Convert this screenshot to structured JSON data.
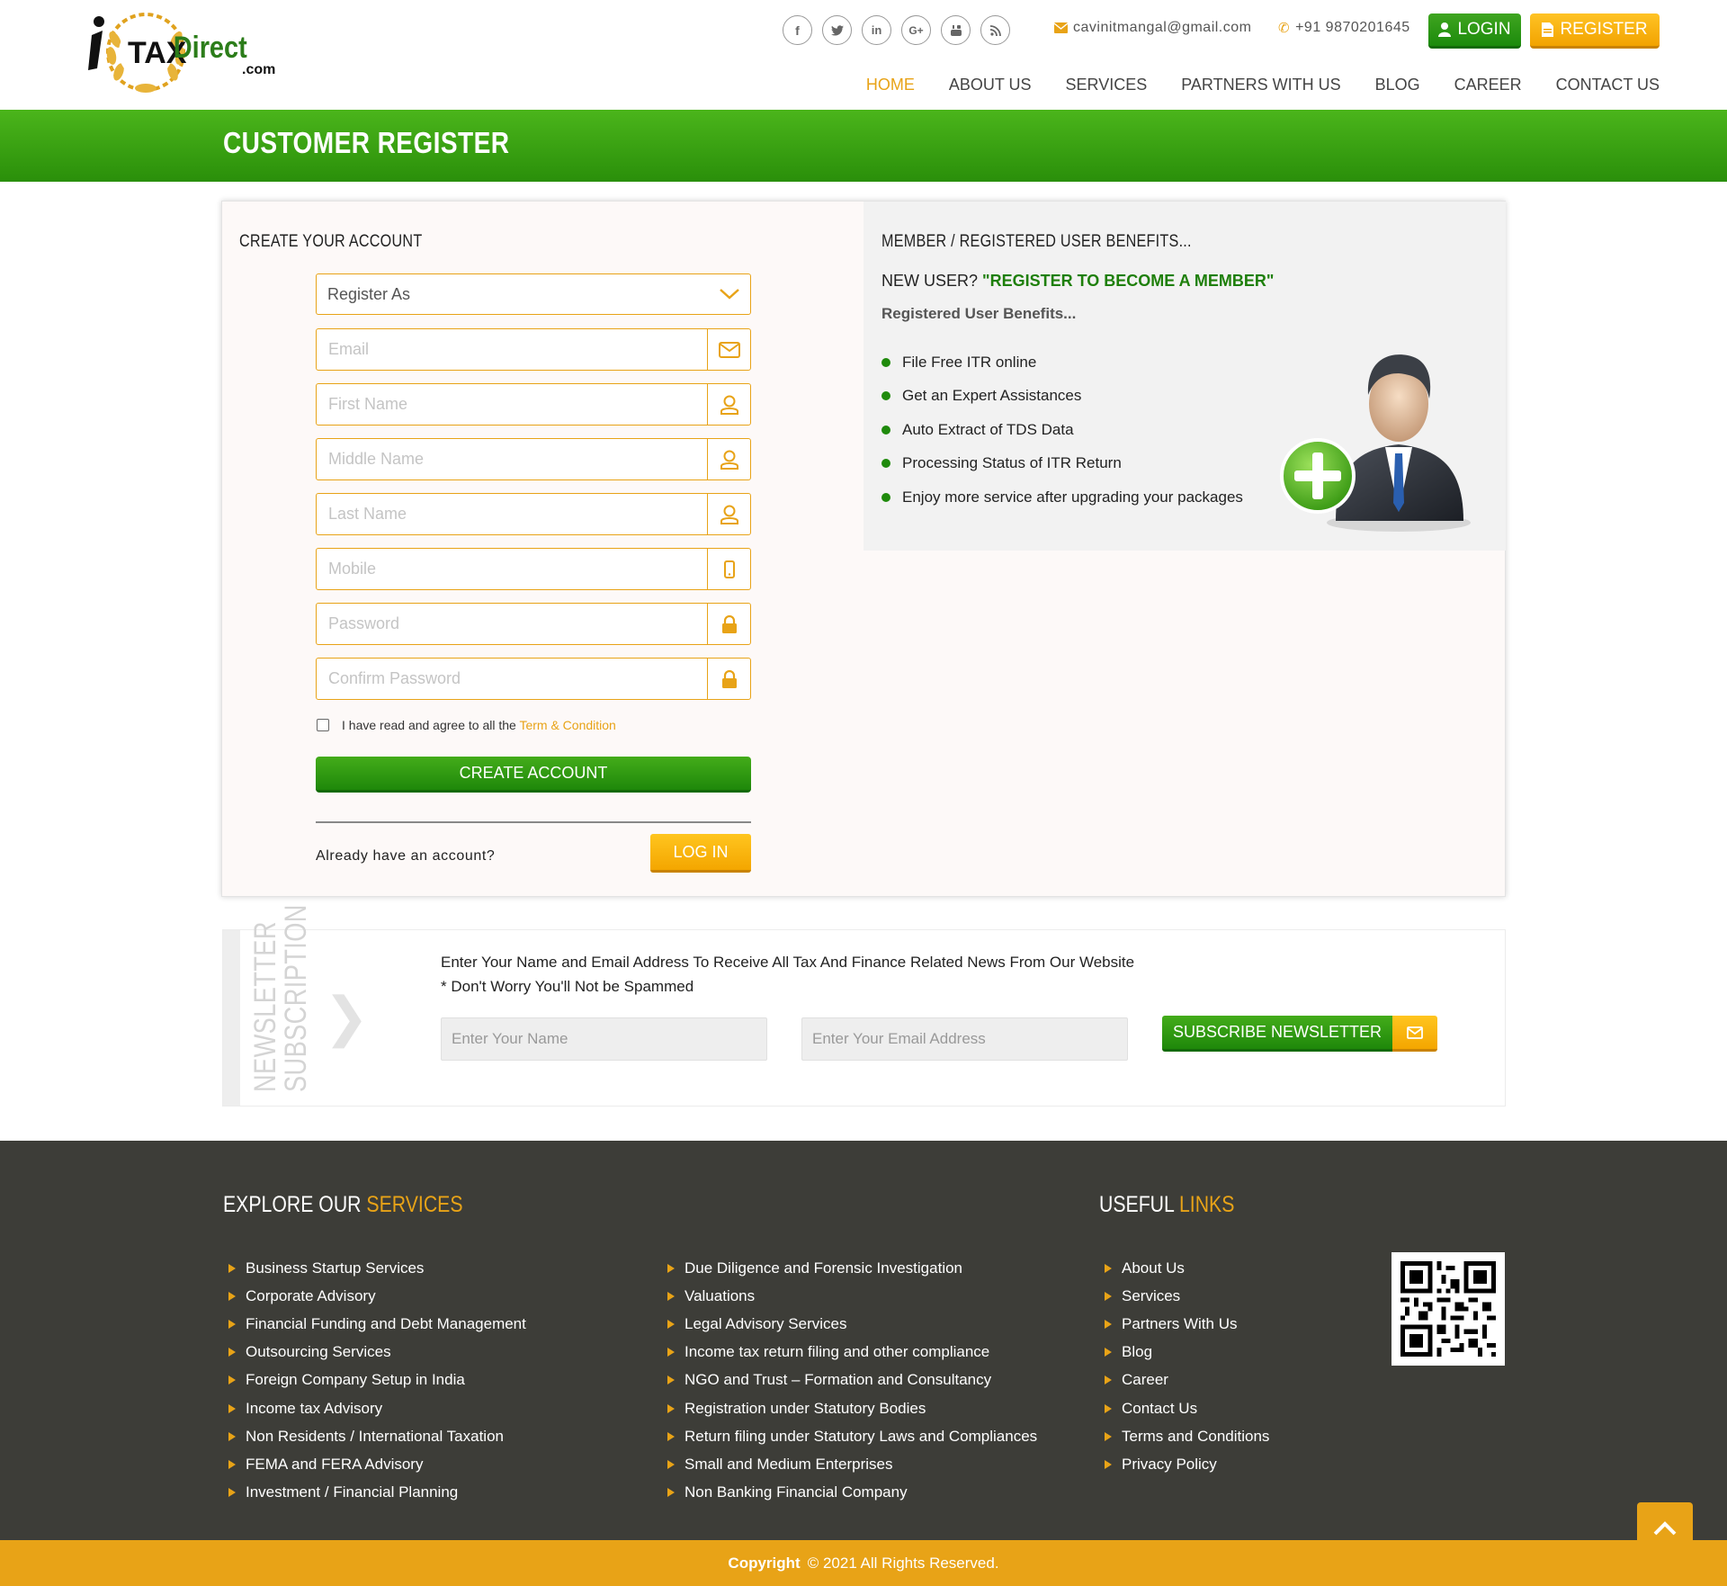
{
  "header": {
    "logo_text_main": "TAX",
    "logo_text_brand": "Direct",
    "logo_text_suffix": ".com",
    "social_icons": [
      "facebook-icon",
      "twitter-icon",
      "linkedin-icon",
      "google-plus-icon",
      "youtube-icon",
      "rss-icon"
    ],
    "email": "cavinitmangal@gmail.com",
    "phone": "+91 9870201645",
    "login_label": "LOGIN",
    "register_label": "REGISTER",
    "nav": [
      "HOME",
      "ABOUT US",
      "SERVICES",
      "PARTNERS WITH US",
      "BLOG",
      "CAREER",
      "CONTACT US"
    ],
    "active_nav": "HOME"
  },
  "banner": {
    "title": "CUSTOMER REGISTER"
  },
  "form": {
    "title": "CREATE YOUR ACCOUNT",
    "register_as": "Register As",
    "placeholders": {
      "email": "Email",
      "first_name": "First Name",
      "middle_name": "Middle Name",
      "last_name": "Last Name",
      "mobile": "Mobile",
      "password": "Password",
      "confirm_password": "Confirm Password"
    },
    "agree_text": "I have read and agree to all the",
    "agree_link": "Term & Condition",
    "create_label": "CREATE ACCOUNT",
    "already_text": "Already have an account?",
    "login_label": "LOG IN"
  },
  "benefits": {
    "title": "MEMBER / REGISTERED USER BENEFITS...",
    "new_user_prefix": "NEW USER?",
    "new_user_cta": "\"REGISTER TO BECOME A MEMBER\"",
    "subtitle": "Registered User Benefits...",
    "items": [
      "File Free ITR online",
      "Get an Expert Assistances",
      "Auto Extract of TDS Data",
      "Processing Status of ITR Return",
      "Enjoy more service after upgrading your packages"
    ]
  },
  "newsletter": {
    "vertical_line1": "NEWSLETTER",
    "vertical_line2": "SUBSCRIPTION",
    "text_line1": "Enter Your Name and Email Address To Receive All Tax And Finance Related News From Our Website",
    "text_line2": "* Don't Worry You'll Not be Spammed",
    "name_placeholder": "Enter Your Name",
    "email_placeholder": "Enter Your Email Address",
    "subscribe_label": "SUBSCRIBE NEWSLETTER"
  },
  "footer": {
    "services_title_a": "EXPLORE OUR",
    "services_title_b": "SERVICES",
    "services_col1": [
      "Business Startup Services",
      "Corporate Advisory",
      "Financial Funding and Debt Management",
      "Outsourcing Services",
      "Foreign Company Setup in India",
      "Income tax Advisory",
      "Non Residents / International Taxation",
      "FEMA and FERA Advisory",
      "Investment / Financial Planning"
    ],
    "services_col2": [
      "Due Diligence and Forensic Investigation",
      "Valuations",
      "Legal Advisory Services",
      "Income tax return filing and other compliance",
      "NGO and Trust – Formation and Consultancy",
      "Registration under Statutory Bodies",
      "Return filing under Statutory Laws and Compliances",
      "Small and Medium Enterprises",
      "Non Banking Financial Company"
    ],
    "links_title_a": "USEFUL",
    "links_title_b": "LINKS",
    "links": [
      "About Us",
      "Services",
      "Partners With Us",
      "Blog",
      "Career",
      "Contact Us",
      "Terms and Conditions",
      "Privacy Policy"
    ],
    "copyright_bold": "Copyright",
    "copyright_rest": "© 2021 All Rights Reserved."
  },
  "colors": {
    "accent": "#e8a317",
    "green": "#2a8f0a",
    "footer_bg": "#3d3d38"
  }
}
